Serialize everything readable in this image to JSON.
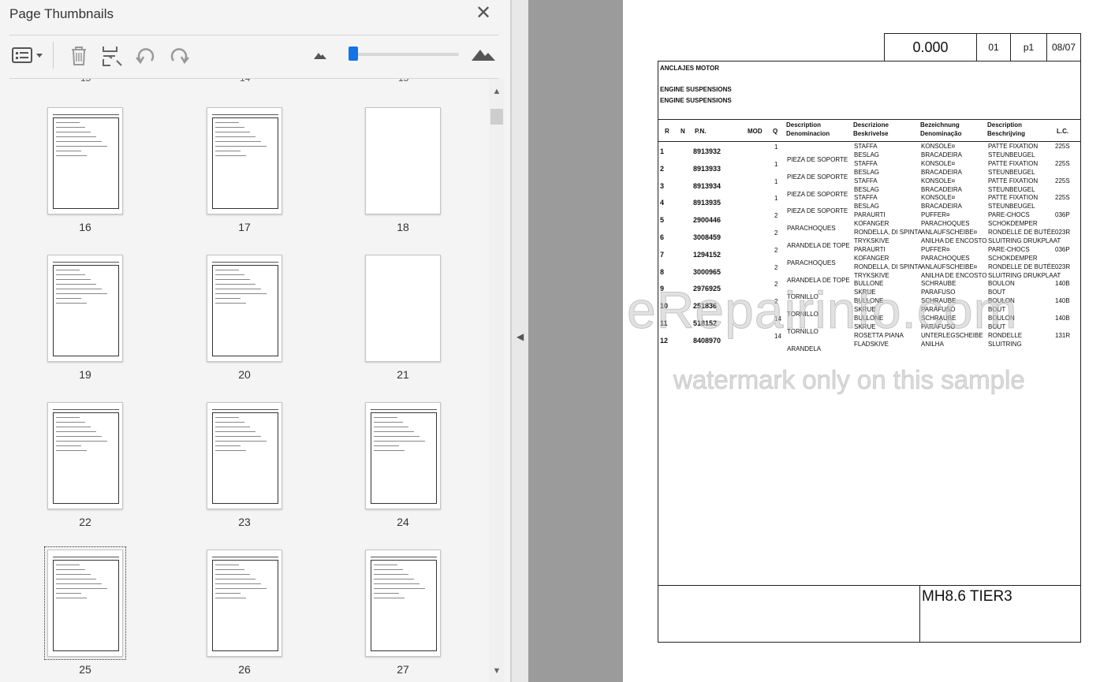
{
  "panel": {
    "title": "Page Thumbnails",
    "cut_numbers": [
      "15",
      "14",
      "15"
    ],
    "thumbs": [
      {
        "num": "16"
      },
      {
        "num": "17"
      },
      {
        "num": "18"
      },
      {
        "num": "19"
      },
      {
        "num": "20"
      },
      {
        "num": "21"
      },
      {
        "num": "22"
      },
      {
        "num": "23"
      },
      {
        "num": "24"
      },
      {
        "num": "25"
      },
      {
        "num": "26"
      },
      {
        "num": "27"
      }
    ]
  },
  "toolbar": {
    "icons": [
      "thumbnail-options-icon",
      "delete-page-icon",
      "insert-page-icon",
      "rotate-left-icon",
      "rotate-right-icon",
      "zoom-out-mountain-icon",
      "zoom-in-mountain-icon"
    ],
    "zoom_level": 0.05,
    "accent": "#1473e6"
  },
  "doc": {
    "header": {
      "code": "0.000",
      "section": "01",
      "page": "p1",
      "date": "08/07"
    },
    "title_es": "ANCLAJES MOTOR",
    "title_en1": "ENGINE SUSPENSIONS",
    "title_en2": "ENGINE SUSPENSIONS",
    "columns": {
      "r": "R",
      "n": "N",
      "pn": "P.N.",
      "mod": "MOD",
      "q": "Q",
      "d1a": "Description",
      "d1b": "Denominacion",
      "d2a": "Descrizione",
      "d2b": "Beskrivelse",
      "d3a": "Bezeichnung",
      "d3b": "Denominação",
      "d4a": "Description",
      "d4b": "Beschrijving",
      "lc": "L.C."
    },
    "rows": [
      {
        "r": "1",
        "pn": "8913932",
        "q": "1",
        "es": "PIEZA DE SOPORTE",
        "it": "STAFFA",
        "dk": "BESLAG",
        "de": "KONSOLE¤",
        "pt": "BRACADEIRA",
        "fr": "PATTE FIXATION",
        "nl": "STEUNBEUGEL",
        "lc": "225S"
      },
      {
        "r": "2",
        "pn": "8913933",
        "q": "1",
        "es": "PIEZA DE SOPORTE",
        "it": "STAFFA",
        "dk": "BESLAG",
        "de": "KONSOLE¤",
        "pt": "BRACADEIRA",
        "fr": "PATTE FIXATION",
        "nl": "STEUNBEUGEL",
        "lc": "225S"
      },
      {
        "r": "3",
        "pn": "8913934",
        "q": "1",
        "es": "PIEZA DE SOPORTE",
        "it": "STAFFA",
        "dk": "BESLAG",
        "de": "KONSOLE¤",
        "pt": "BRACADEIRA",
        "fr": "PATTE FIXATION",
        "nl": "STEUNBEUGEL",
        "lc": "225S"
      },
      {
        "r": "4",
        "pn": "8913935",
        "q": "1",
        "es": "PIEZA DE SOPORTE",
        "it": "STAFFA",
        "dk": "BESLAG",
        "de": "KONSOLE¤",
        "pt": "BRACADEIRA",
        "fr": "PATTE FIXATION",
        "nl": "STEUNBEUGEL",
        "lc": "225S"
      },
      {
        "r": "5",
        "pn": "2900446",
        "q": "2",
        "es": "PARACHOQUES",
        "it": "PARAURTI",
        "dk": "KOFANGER",
        "de": "PUFFER¤",
        "pt": "PARACHOQUES",
        "fr": "PARE-CHOCS",
        "nl": "SCHOKDEMPER",
        "lc": "036P"
      },
      {
        "r": "6",
        "pn": "3008459",
        "q": "2",
        "es": "ARANDELA DE TOPE",
        "it": "RONDELLA, DI SPINTA",
        "dk": "TRYKSKIVE",
        "de": "ANLAUFSCHEIBE¤",
        "pt": "ANILHA DE ENCOSTO",
        "fr": "RONDELLE DE BUTÉE",
        "nl": "SLUITRING DRUKPLAAT",
        "lc": "023R"
      },
      {
        "r": "7",
        "pn": "1294152",
        "q": "2",
        "es": "PARACHOQUES",
        "it": "PARAURTI",
        "dk": "KOFANGER",
        "de": "PUFFER¤",
        "pt": "PARACHOQUES",
        "fr": "PARE-CHOCS",
        "nl": "SCHOKDEMPER",
        "lc": "036P"
      },
      {
        "r": "8",
        "pn": "3000965",
        "q": "2",
        "es": "ARANDELA DE TOPE",
        "it": "RONDELLA, DI SPINTA",
        "dk": "TRYKSKIVE",
        "de": "ANLAUFSCHEIBE¤",
        "pt": "ANILHA DE ENCOSTO",
        "fr": "RONDELLE DE BUTÉE",
        "nl": "SLUITRING DRUKPLAAT",
        "lc": "023R"
      },
      {
        "r": "9",
        "pn": "2976925",
        "q": "2",
        "es": "TORNILLO",
        "it": "BULLONE",
        "dk": "SKRUE",
        "de": "SCHRAUBE",
        "pt": "PARAFUSO",
        "fr": "BOULON",
        "nl": "BOUT",
        "lc": "140B"
      },
      {
        "r": "10",
        "pn": "251836",
        "q": "2",
        "es": "TORNILLO",
        "it": "BULLONE",
        "dk": "SKRUE",
        "de": "SCHRAUBE",
        "pt": "PARAFUSO",
        "fr": "BOULON",
        "nl": "BOUT",
        "lc": "140B"
      },
      {
        "r": "11",
        "pn": "518152",
        "q": "14",
        "es": "TORNILLO",
        "it": "BULLONE",
        "dk": "SKRUE",
        "de": "SCHRAUBE",
        "pt": "PARAFUSO",
        "fr": "BOULON",
        "nl": "BOUT",
        "lc": "140B"
      },
      {
        "r": "12",
        "pn": "8408970",
        "q": "14",
        "es": "ARANDELA",
        "it": "ROSETTA PIANA",
        "dk": "FLADSKIVE",
        "de": "UNTERLEGSCHEIBE",
        "pt": "ANILHA",
        "fr": "RONDELLE",
        "nl": "SLUITRING",
        "lc": "131R"
      }
    ],
    "model": "MH8.6 TIER3",
    "watermark": "eRepairinfo.com",
    "watermark_note": "watermark only on this sample"
  }
}
